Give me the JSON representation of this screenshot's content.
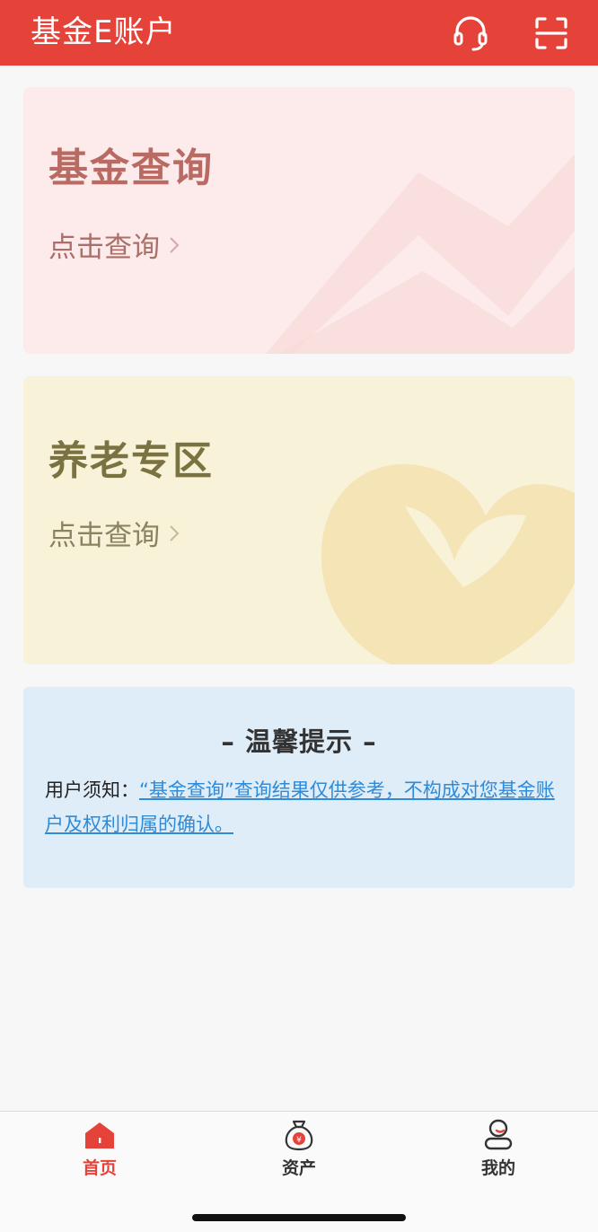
{
  "header": {
    "title": "基金E账户",
    "bg_color": "#e5433a",
    "icons": [
      "headset-icon",
      "scan-icon"
    ]
  },
  "cards": [
    {
      "title": "基金查询",
      "link": "点击查询",
      "icon": "chevron-right-icon",
      "bg_color": "#fcebea"
    },
    {
      "title": "养老专区",
      "link": "点击查询",
      "icon": "chevron-right-icon",
      "bg_color": "#f7f2d8"
    }
  ],
  "notice": {
    "title": "– 温馨提示 –",
    "prefix": "用户须知：",
    "link_text": "“基金查询”查询结果仅供参考，不构成对您基金账户及权利归属的确认。",
    "bg_color": "#dfedf8",
    "link_color": "#2f8ad8"
  },
  "tabbar": {
    "active_color": "#e5433a",
    "tabs": [
      {
        "label": "首页",
        "icon": "home-icon",
        "active": true
      },
      {
        "label": "资产",
        "icon": "money-bag-icon",
        "active": false
      },
      {
        "label": "我的",
        "icon": "user-icon",
        "active": false
      }
    ]
  }
}
